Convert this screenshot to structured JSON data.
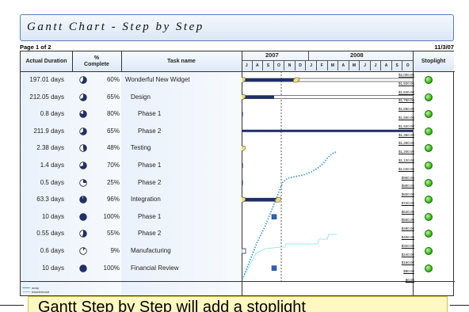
{
  "title": "Gantt Chart - Step by Step",
  "page_label": "Page 1 of 2",
  "date": "11/3/07",
  "headers": {
    "actual_duration": "Actual Duration",
    "percent": "%",
    "complete": "Complete",
    "task_name": "Task name",
    "stoplight": "Stoplight"
  },
  "timeline": {
    "year1": "2007",
    "year2": "2008",
    "months_2007": [
      "J",
      "A",
      "S",
      "O",
      "N",
      "D"
    ],
    "months_2008": [
      "J",
      "F",
      "M",
      "A",
      "M",
      "J",
      "J",
      "A",
      "S",
      "O"
    ]
  },
  "tasks": [
    {
      "duration": "197.01 days",
      "percent": "60%",
      "pct": 0.6,
      "name": "Wonderful New Widget",
      "level": 0,
      "stoplight": "green"
    },
    {
      "duration": "212.05 days",
      "percent": "65%",
      "pct": 0.65,
      "name": "Design",
      "level": 1,
      "stoplight": "green"
    },
    {
      "duration": "0.8 days",
      "percent": "80%",
      "pct": 0.8,
      "name": "Phase 1",
      "level": 2,
      "stoplight": "green"
    },
    {
      "duration": "211.9 days",
      "percent": "65%",
      "pct": 0.65,
      "name": "Phase 2",
      "level": 2,
      "stoplight": "green"
    },
    {
      "duration": "2.38 days",
      "percent": "48%",
      "pct": 0.48,
      "name": "Testing",
      "level": 1,
      "stoplight": "green"
    },
    {
      "duration": "1.4 days",
      "percent": "70%",
      "pct": 0.7,
      "name": "Phase 1",
      "level": 2,
      "stoplight": "green"
    },
    {
      "duration": "0.5 days",
      "percent": "25%",
      "pct": 0.25,
      "name": "Phase 2",
      "level": 2,
      "stoplight": "green"
    },
    {
      "duration": "63.3 days",
      "percent": "96%",
      "pct": 0.96,
      "name": "Integration",
      "level": 1,
      "stoplight": "green"
    },
    {
      "duration": "10 days",
      "percent": "100%",
      "pct": 1.0,
      "name": "Phase 1",
      "level": 2,
      "stoplight": "green"
    },
    {
      "duration": "0.55 days",
      "percent": "55%",
      "pct": 0.55,
      "name": "Phase 2",
      "level": 2,
      "stoplight": "green"
    },
    {
      "duration": "0.6 days",
      "percent": "9%",
      "pct": 0.09,
      "name": "Manufacturing",
      "level": 1,
      "stoplight": "green"
    },
    {
      "duration": "10 days",
      "percent": "100%",
      "pct": 1.0,
      "name": "Financial Review",
      "level": 1,
      "stoplight": "green"
    }
  ],
  "cost_axis": [
    "$2,000.00",
    "$1,920.00",
    "$1,840.00",
    "$1,760.00",
    "$1,680.00",
    "$1,600.00",
    "$1,520.00",
    "$1,360.00",
    "$1,280.00",
    "$1,200.00",
    "$1,120.00",
    "$1,040.00",
    "$960.00",
    "$880.00",
    "$800.00",
    "$720.00",
    "$640.00",
    "$560.00",
    "$480.00",
    "$400.00",
    "$320.00",
    "$240.00",
    "$160.00",
    "$80.00",
    "$0.00"
  ],
  "legend": {
    "actual": "acwp",
    "baseline": "baselinecost"
  },
  "caption": "Gantt Step by Step will add a stoplight",
  "colors": {
    "stoplight_green": "#3bbd1b",
    "cost_line": "#2f8fd8",
    "baseline_line": "#7fe0f0",
    "bar_navy": "#1f2f6b",
    "milestone_yellow": "#f5e06a"
  }
}
